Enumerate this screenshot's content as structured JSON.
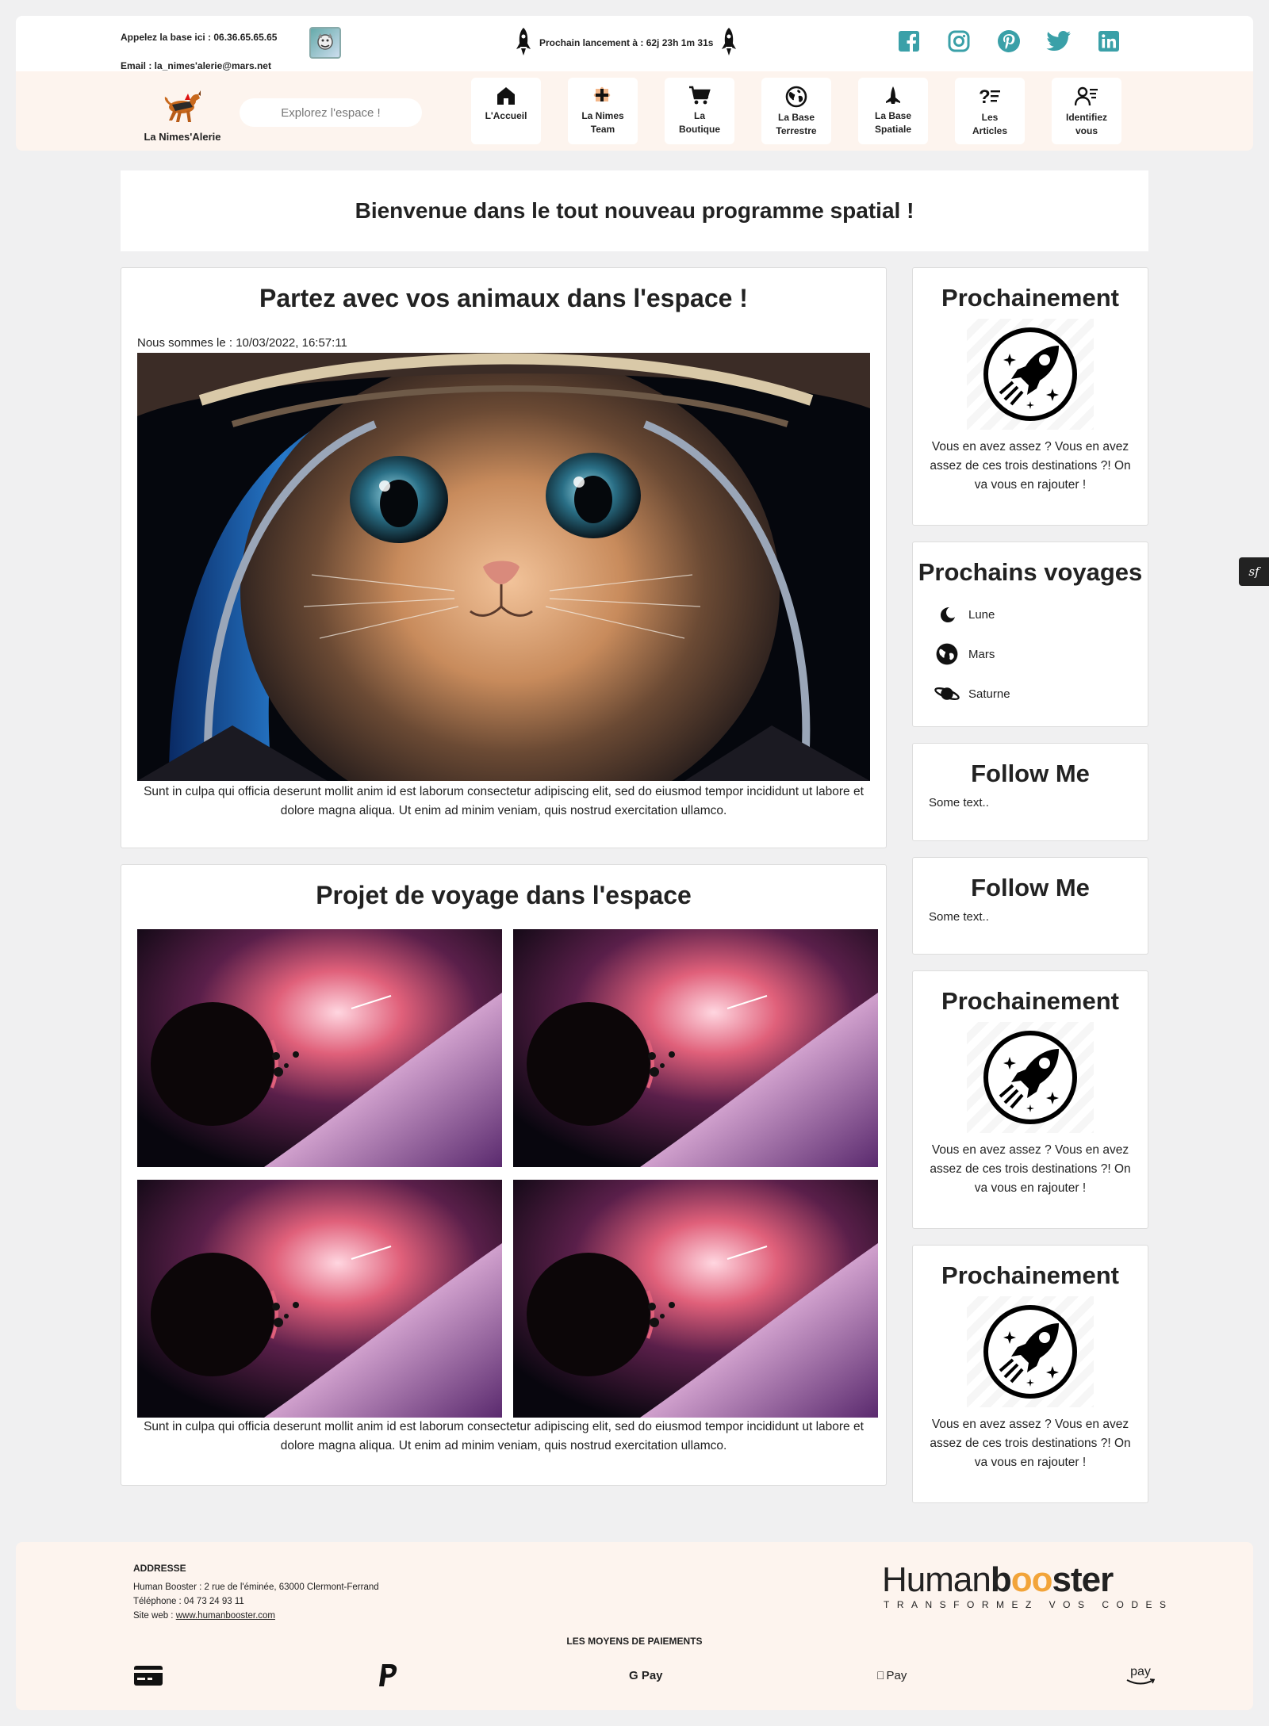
{
  "topbar": {
    "phone": "Appelez la base ici : 06.36.65.65.65",
    "email": "Email : la_nimes'alerie@mars.net",
    "countdown": "Prochain lancement à : 62j 23h 1m 31s",
    "socials": [
      "facebook-icon",
      "instagram-icon",
      "pinterest-icon",
      "twitter-icon",
      "linkedin-icon"
    ],
    "social_color": "#3aa0a8"
  },
  "nav": {
    "brand": "La Nimes'Alerie",
    "search_placeholder": "Explorez l'espace !",
    "items": [
      {
        "line1": "L'Accueil",
        "line2": ""
      },
      {
        "line1": "La Nimes",
        "line2": "Team"
      },
      {
        "line1": "La",
        "line2": "Boutique"
      },
      {
        "line1": "La Base",
        "line2": "Terrestre"
      },
      {
        "line1": "La Base",
        "line2": "Spatiale"
      },
      {
        "line1": "Les",
        "line2": "Articles"
      },
      {
        "line1": "Identifiez",
        "line2": "vous"
      }
    ]
  },
  "welcome": "Bienvenue dans le tout nouveau programme spatial !",
  "article1": {
    "title": "Partez avec vos animaux dans l'espace !",
    "date": "Nous sommes le : 10/03/2022, 16:57:11",
    "text": "Sunt in culpa qui officia deserunt mollit anim id est laborum consectetur adipiscing elit, sed do eiusmod tempor incididunt ut labore et dolore magna aliqua. Ut enim ad minim veniam, quis nostrud exercitation ullamco."
  },
  "article2": {
    "title": "Projet de voyage dans l'espace",
    "text": "Sunt in culpa qui officia deserunt mollit anim id est laborum consectetur adipiscing elit, sed do eiusmod tempor incididunt ut labore et dolore magna aliqua. Ut enim ad minim veniam, quis nostrud exercitation ullamco."
  },
  "sidebar": {
    "prochainement_title": "Prochainement",
    "prochainement_text": "Vous en avez assez ? Vous en avez assez de ces trois destinations ?! On va vous en rajouter !",
    "voyages_title": "Prochains voyages",
    "voyages": [
      "Lune",
      "Mars",
      "Saturne"
    ],
    "follow_title": "Follow Me",
    "follow_text": "Some text.."
  },
  "footer": {
    "addr_title": "ADDRESSE",
    "addr_line": "Human Booster : 2 rue de l'éminée, 63000 Clermont-Ferrand",
    "phone_line": "Téléphone : 04 73 24 93 11",
    "site_label": "Site web : ",
    "site_link": "www.humanbooster.com",
    "logo_a": "Human",
    "logo_b": "b",
    "logo_oo": "oo",
    "logo_c": "ster",
    "logo_tagline": "TRANSFORMEZ VOS CODES",
    "payments_title": "LES MOYENS DE PAIEMENTS",
    "payments": {
      "gpay": "G Pay",
      "applepay": "Pay",
      "amazon": "pay"
    }
  }
}
